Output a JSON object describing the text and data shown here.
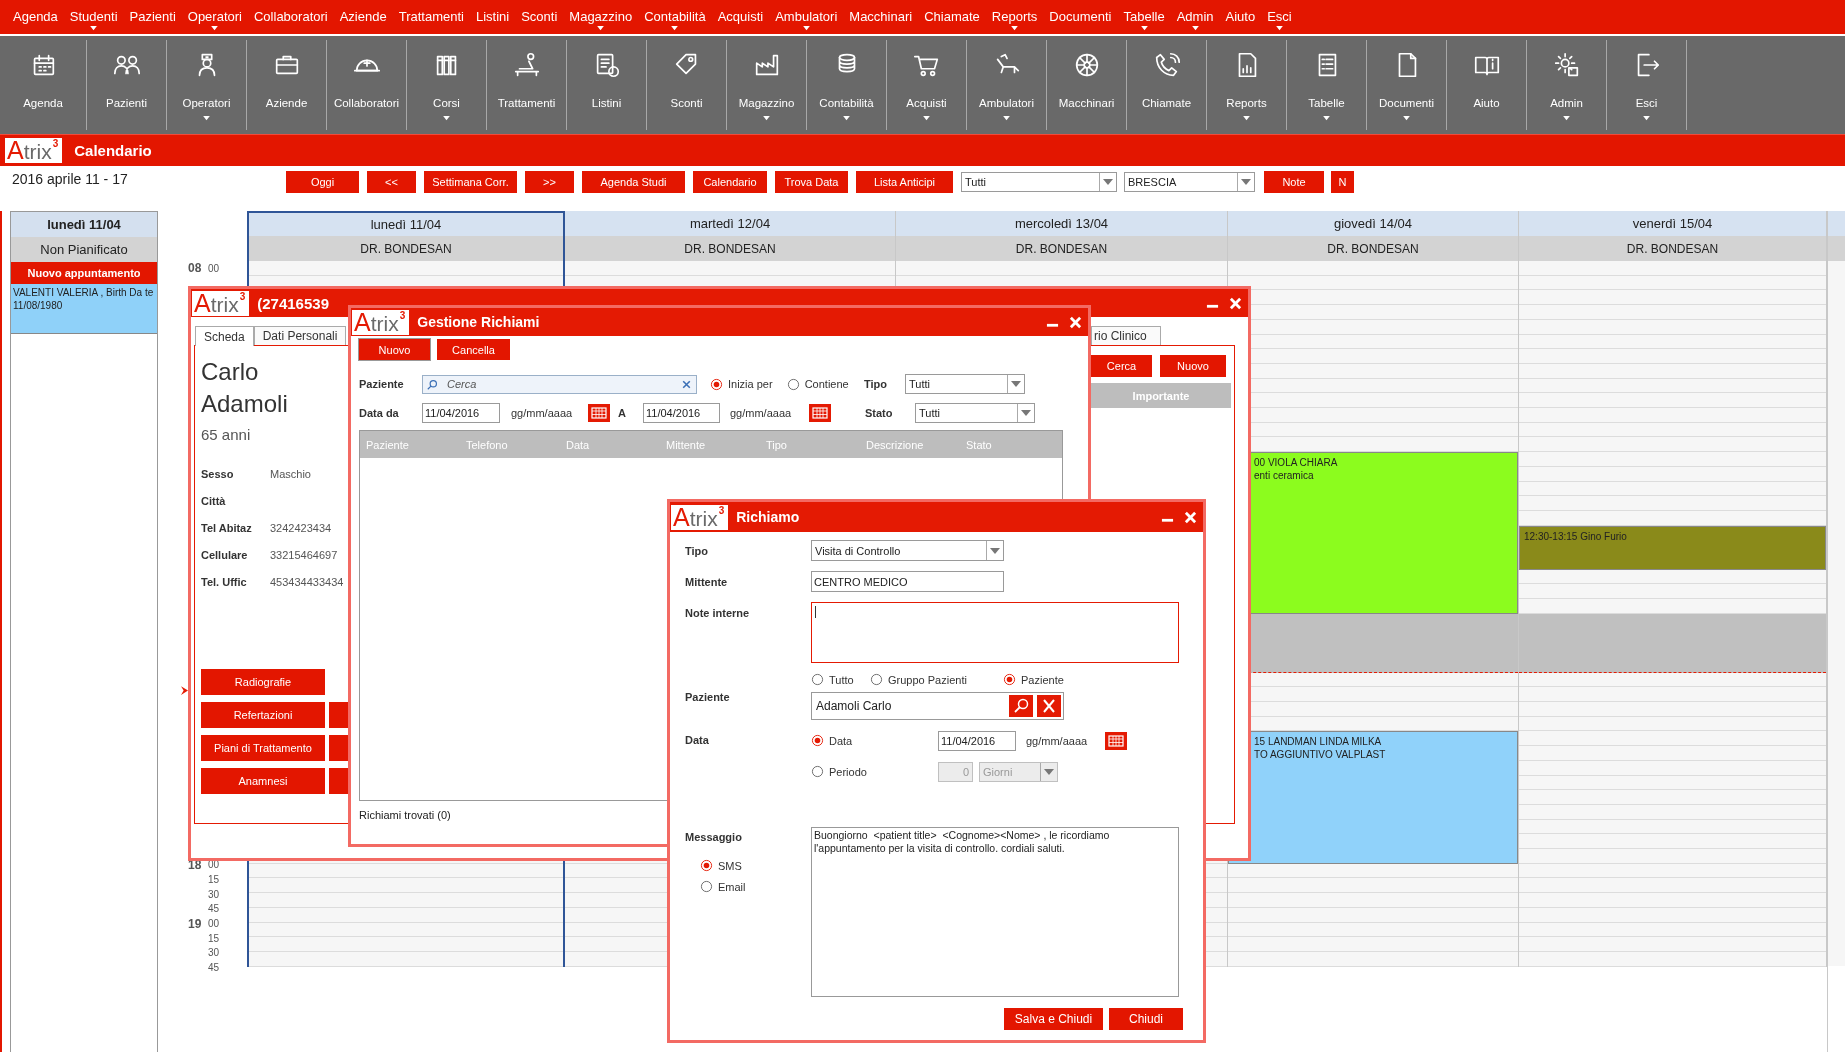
{
  "menu_bar": [
    {
      "label": "Agenda",
      "has_menu": false
    },
    {
      "label": "Studenti",
      "has_menu": true
    },
    {
      "label": "Pazienti",
      "has_menu": false
    },
    {
      "label": "Operatori",
      "has_menu": true
    },
    {
      "label": "Collaboratori",
      "has_menu": false
    },
    {
      "label": "Aziende",
      "has_menu": false
    },
    {
      "label": "Trattamenti",
      "has_menu": false
    },
    {
      "label": "Listini",
      "has_menu": false
    },
    {
      "label": "Sconti",
      "has_menu": false
    },
    {
      "label": "Magazzino",
      "has_menu": true
    },
    {
      "label": "Contabilità",
      "has_menu": true
    },
    {
      "label": "Acquisti",
      "has_menu": false
    },
    {
      "label": "Ambulatori",
      "has_menu": true
    },
    {
      "label": "Macchinari",
      "has_menu": false
    },
    {
      "label": "Chiamate",
      "has_menu": false
    },
    {
      "label": "Reports",
      "has_menu": true
    },
    {
      "label": "Documenti",
      "has_menu": false
    },
    {
      "label": "Tabelle",
      "has_menu": true
    },
    {
      "label": "Admin",
      "has_menu": true
    },
    {
      "label": "Aiuto",
      "has_menu": false
    },
    {
      "label": "Esci",
      "has_menu": true
    }
  ],
  "toolbar": [
    {
      "label": "Agenda",
      "has_menu": false
    },
    {
      "label": "Pazienti",
      "has_menu": false
    },
    {
      "label": "Operatori",
      "has_menu": true
    },
    {
      "label": "Aziende",
      "has_menu": false
    },
    {
      "label": "Collaboratori",
      "has_menu": false
    },
    {
      "label": "Corsi",
      "has_menu": true
    },
    {
      "label": "Trattamenti",
      "has_menu": false
    },
    {
      "label": "Listini",
      "has_menu": false
    },
    {
      "label": "Sconti",
      "has_menu": false
    },
    {
      "label": "Magazzino",
      "has_menu": true
    },
    {
      "label": "Contabilità",
      "has_menu": true
    },
    {
      "label": "Acquisti",
      "has_menu": true
    },
    {
      "label": "Ambulatori",
      "has_menu": true
    },
    {
      "label": "Macchinari",
      "has_menu": false
    },
    {
      "label": "Chiamate",
      "has_menu": false
    },
    {
      "label": "Reports",
      "has_menu": true
    },
    {
      "label": "Tabelle",
      "has_menu": true
    },
    {
      "label": "Documenti",
      "has_menu": true
    },
    {
      "label": "Aiuto",
      "has_menu": false
    },
    {
      "label": "Admin",
      "has_menu": true
    },
    {
      "label": "Esci",
      "has_menu": true
    }
  ],
  "app_header": {
    "logo": {
      "letter": "A",
      "rest": "trix",
      "sup": "3"
    },
    "title": "Calendario"
  },
  "date_range": "2016 aprile 11 - 17",
  "nav_buttons": [
    "Oggi",
    "<<",
    "Settimana Corr.",
    ">>",
    "Agenda Studi",
    "Calendario",
    "Trova Data",
    "Lista Anticipi"
  ],
  "filters": [
    {
      "value": "Tutti"
    },
    {
      "value": "BRESCIA"
    }
  ],
  "extra_buttons": [
    "Note",
    "N"
  ],
  "unplanned": {
    "day": "lunedì 11/04",
    "title": "Non Pianificato",
    "new_button": "Nuovo appuntamento",
    "items": [
      {
        "text": "VALENTI VALERIA , Birth Da te 11/08/1980"
      }
    ]
  },
  "time_labels_top": [
    {
      "hour": "08",
      "minute": "00"
    }
  ],
  "time_labels_bottom": [
    {
      "hour": "18",
      "minute": "00"
    },
    {
      "minute": "15"
    },
    {
      "minute": "30"
    },
    {
      "minute": "45"
    },
    {
      "hour": "19",
      "minute": "00"
    },
    {
      "minute": "15"
    },
    {
      "minute": "30"
    },
    {
      "minute": "45"
    }
  ],
  "days": [
    {
      "label": "lunedì 11/04",
      "doctor": "DR. BONDESAN",
      "selected": true
    },
    {
      "label": "martedì 12/04",
      "doctor": "DR. BONDESAN",
      "selected": false
    },
    {
      "label": "mercoledì 13/04",
      "doctor": "DR. BONDESAN",
      "selected": false
    },
    {
      "label": "giovedì 14/04",
      "doctor": "DR. BONDESAN",
      "selected": false,
      "appointments": [
        {
          "color": "#8cfc1e",
          "lines": [
            "00 VIOLA CHIARA",
            "enti ceramica"
          ]
        },
        {
          "color": "#90d2fa",
          "lines": [
            "15 LANDMAN LINDA MILKA",
            "TO AGGIUNTIVO VALPLAST"
          ]
        }
      ]
    },
    {
      "label": "venerdì 15/04",
      "doctor": "DR. BONDESAN",
      "selected": false,
      "appointments": [
        {
          "color": "#8a8a1a",
          "lines": [
            "12:30-13:15 Gino Furio"
          ]
        }
      ]
    }
  ],
  "patient_window": {
    "logo": {
      "letter": "A",
      "rest": "trix",
      "sup": "3"
    },
    "title": "(27416539",
    "tabs": [
      {
        "label": "Scheda",
        "selected": true
      },
      {
        "label": "Dati Personali",
        "selected": false
      }
    ],
    "side_tab": {
      "label": "rio Clinico",
      "selected": false
    },
    "first_name": "Carlo",
    "last_name": "Adamoli",
    "age": "65 anni",
    "fields": [
      {
        "label": "Sesso",
        "value": "Maschio"
      },
      {
        "label": "Città"
      },
      {
        "label": "Tel Abitaz",
        "value": "3242423434"
      },
      {
        "label": "Cellulare",
        "value": "33215464697"
      },
      {
        "label": "Tel. Uffic",
        "value": "453434433434"
      }
    ],
    "buttons": [
      "Radiografie",
      "Refertazioni",
      "Piani di Trattamento",
      "Anamnesi"
    ],
    "side_buttons": [
      "Cerca",
      "Nuovo"
    ],
    "flag_button": "Importante"
  },
  "recall_manager": {
    "logo": {
      "letter": "A",
      "rest": "trix",
      "sup": "3"
    },
    "title": "Gestione Richiami",
    "buttons": [
      "Nuovo",
      "Cancella"
    ],
    "patient_label": "Paziente",
    "search_placeholder": "Cerca",
    "match_options": [
      {
        "label": "Inizia per",
        "selected": true
      },
      {
        "label": "Contiene",
        "selected": false
      }
    ],
    "type_label": "Tipo",
    "type_value": "Tutti",
    "date_from_label": "Data da",
    "date_from": "11/04/2016",
    "date_from_format": "gg/mm/aaaa",
    "date_to_label": "A",
    "date_to": "11/04/2016",
    "date_to_format": "gg/mm/aaaa",
    "status_label": "Stato",
    "status_value": "Tutti",
    "columns": [
      "Paziente",
      "Telefono",
      "Data",
      "Mittente",
      "Tipo",
      "Descrizione",
      "Stato"
    ],
    "footer": "Richiami trovati (0)"
  },
  "recall": {
    "logo": {
      "letter": "A",
      "rest": "trix",
      "sup": "3"
    },
    "title": "Richiamo",
    "type_label": "Tipo",
    "type_value": "Visita di Controllo",
    "sender_label": "Mittente",
    "sender": "CENTRO MEDICO",
    "notes_label": "Note interne",
    "patient_label": "Paziente",
    "patient_scope": [
      {
        "label": "Tutto",
        "selected": false
      },
      {
        "label": "Gruppo Pazienti",
        "selected": false
      },
      {
        "label": "Paziente",
        "selected": true
      }
    ],
    "patient_name": "Adamoli Carlo",
    "date_label": "Data",
    "date_modes": [
      {
        "label": "Data",
        "selected": true
      },
      {
        "label": "Periodo",
        "selected": false
      }
    ],
    "date_value": "11/04/2016",
    "date_format": "gg/mm/aaaa",
    "period_value": "0",
    "period_unit": "Giorni",
    "period_disabled": true,
    "message_label": "Messaggio",
    "channels": [
      {
        "label": "SMS",
        "selected": true
      },
      {
        "label": "Email",
        "selected": false
      }
    ],
    "message": "Buongiorno  <patient title>  <Cognome><Nome> , le ricordiamo\nl'appuntamento per la visita di controllo. cordiali saluti.",
    "buttons": [
      "Salva e Chiudi",
      "Chiudi"
    ]
  }
}
